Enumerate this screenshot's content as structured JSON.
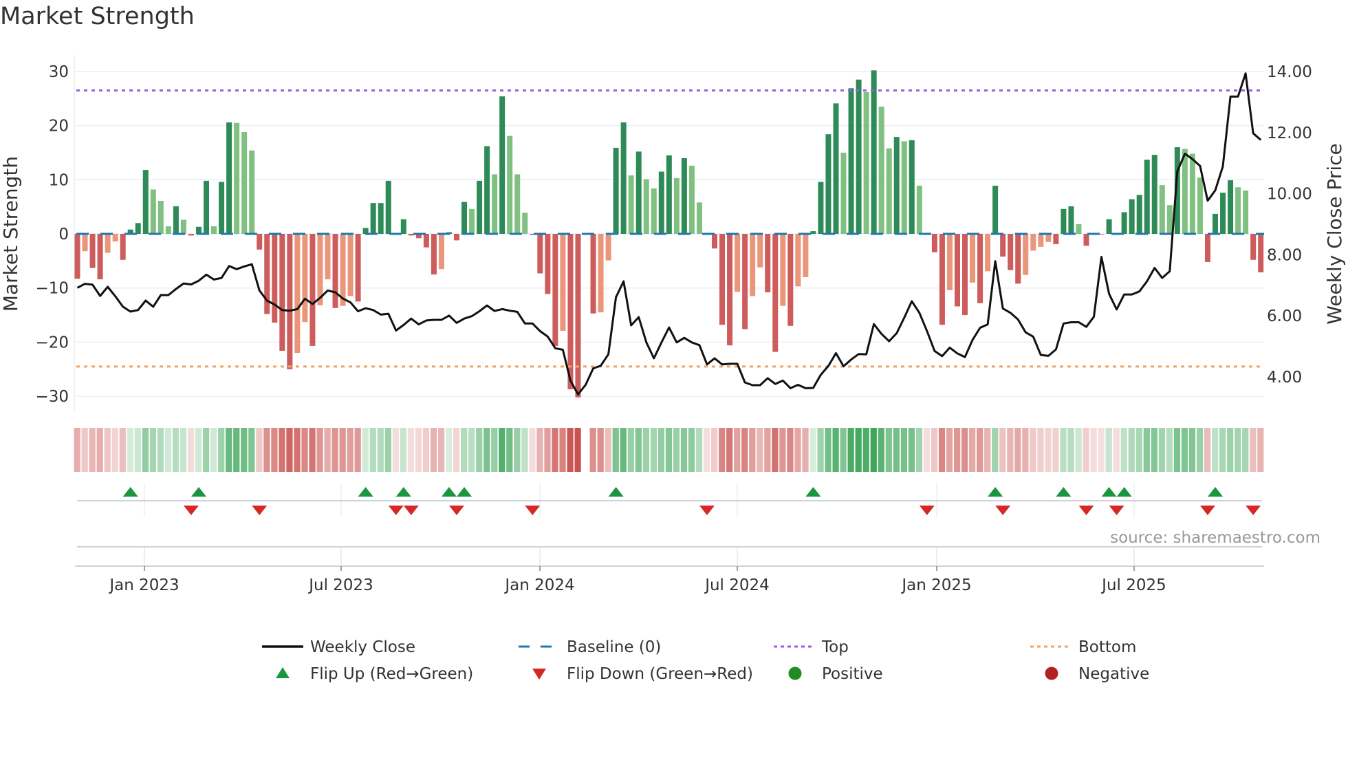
{
  "title": "Market Strength",
  "source": "source: sharemaestro.com",
  "chart_data": {
    "type": "bar+line",
    "title": "Market Strength",
    "ylabel_left": "Market Strength",
    "ylabel_right": "Weekly Close Price",
    "ylim_left": [
      -33,
      33
    ],
    "ylim_right": [
      3.2,
      14.6
    ],
    "left_ticks": [
      30,
      20,
      10,
      0,
      -10,
      -20,
      -30
    ],
    "left_tick_labels": [
      "30",
      "20",
      "10",
      "0",
      "−10",
      "−20",
      "−30"
    ],
    "right_ticks": [
      14,
      12,
      10,
      8,
      6,
      4
    ],
    "right_tick_labels": [
      "14.00",
      "12.00",
      "10.00",
      "8.00",
      "6.00",
      "4.00"
    ],
    "x_ticks_week_index": [
      8.84,
      34.77,
      60.97,
      86.99,
      113.28,
      139.3
    ],
    "x_tick_labels": [
      "Jan 2023",
      "Jul 2023",
      "Jan 2024",
      "Jul 2024",
      "Jan 2025",
      "Jul 2025"
    ],
    "grid": true,
    "top_level": 26.5,
    "bottom_level": -24.5,
    "baseline": 0,
    "strength": [
      -8.3,
      -3.2,
      -6.3,
      -8.4,
      -3.5,
      -1.4,
      -4.8,
      0.8,
      2.0,
      11.8,
      8.2,
      6.1,
      1.4,
      5.1,
      2.6,
      -0.3,
      1.3,
      9.8,
      1.4,
      9.6,
      20.6,
      20.5,
      18.8,
      15.4,
      -2.9,
      -14.8,
      -16.4,
      -21.6,
      -25.0,
      -22.0,
      -16.3,
      -20.7,
      -13.2,
      -8.4,
      -13.7,
      -13.3,
      -11.5,
      -12.5,
      1.1,
      5.7,
      5.7,
      9.8,
      -0.2,
      2.7,
      -0.3,
      -0.8,
      -2.5,
      -7.5,
      -6.5,
      0.3,
      -1.2,
      5.9,
      4.6,
      9.8,
      16.2,
      11.0,
      25.4,
      18.1,
      11.0,
      3.9,
      -0.2,
      -7.3,
      -11.1,
      -20.7,
      -17.9,
      -28.7,
      -30.2,
      0,
      -14.7,
      -14.5,
      -4.9,
      15.9,
      20.6,
      10.8,
      15.2,
      10.1,
      8.4,
      11.5,
      14.5,
      10.3,
      14.0,
      12.6,
      5.8,
      -0.2,
      -2.7,
      -16.8,
      -20.6,
      -10.7,
      -17.6,
      -11.5,
      -6.2,
      -10.8,
      -21.8,
      -13.3,
      -17.0,
      -9.7,
      -8.0,
      0.5,
      9.6,
      18.4,
      24.1,
      15.0,
      26.9,
      28.5,
      26.2,
      30.2,
      23.5,
      15.8,
      17.9,
      17.1,
      17.3,
      8.9,
      -0.2,
      -3.4,
      -16.8,
      -10.4,
      -13.4,
      -15.0,
      -9.0,
      -12.8,
      -6.9,
      8.9,
      -4.2,
      -6.7,
      -9.2,
      -7.6,
      -3.1,
      -2.4,
      -1.5,
      -1.9,
      4.6,
      5.1,
      1.8,
      -2.2,
      -0.2,
      -0.1,
      2.7,
      -0.2,
      4.0,
      6.4,
      7.2,
      13.7,
      14.6,
      9.0,
      5.3,
      16.0,
      15.7,
      14.8,
      10.4,
      -5.2,
      3.7,
      7.6,
      9.9,
      8.6,
      8.0,
      -4.8,
      -7.1
    ],
    "weekly_close": [
      6.92,
      7.05,
      7.02,
      6.65,
      6.95,
      6.64,
      6.3,
      6.14,
      6.19,
      6.5,
      6.3,
      6.68,
      6.68,
      6.88,
      7.06,
      7.03,
      7.15,
      7.35,
      7.19,
      7.24,
      7.63,
      7.53,
      7.62,
      7.69,
      6.83,
      6.5,
      6.37,
      6.19,
      6.17,
      6.22,
      6.56,
      6.39,
      6.59,
      6.83,
      6.77,
      6.57,
      6.44,
      6.15,
      6.25,
      6.19,
      6.04,
      6.07,
      5.52,
      5.7,
      5.91,
      5.72,
      5.85,
      5.87,
      5.87,
      6.01,
      5.77,
      5.91,
      5.99,
      6.15,
      6.34,
      6.16,
      6.22,
      6.17,
      6.13,
      5.75,
      5.75,
      5.5,
      5.32,
      4.94,
      4.89,
      3.88,
      3.43,
      3.74,
      4.28,
      4.37,
      4.74,
      6.61,
      7.13,
      5.69,
      5.96,
      5.13,
      4.61,
      5.13,
      5.62,
      5.13,
      5.28,
      5.13,
      5.04,
      4.41,
      4.61,
      4.41,
      4.43,
      4.43,
      3.82,
      3.73,
      3.73,
      3.96,
      3.77,
      3.88,
      3.63,
      3.74,
      3.63,
      3.64,
      4.07,
      4.36,
      4.78,
      4.35,
      4.57,
      4.75,
      4.74,
      5.73,
      5.41,
      5.17,
      5.43,
      5.94,
      6.48,
      6.1,
      5.5,
      4.85,
      4.68,
      4.96,
      4.77,
      4.65,
      5.21,
      5.61,
      5.72,
      7.79,
      6.24,
      6.1,
      5.88,
      5.46,
      5.32,
      4.72,
      4.69,
      4.9,
      5.75,
      5.79,
      5.79,
      5.64,
      5.97,
      7.93,
      6.72,
      6.21,
      6.7,
      6.7,
      6.8,
      7.13,
      7.57,
      7.24,
      7.46,
      10.73,
      11.31,
      11.13,
      10.91,
      9.77,
      10.11,
      10.89,
      13.18,
      13.18,
      13.94,
      11.98,
      11.76
    ],
    "flip_up_weeks": [
      7,
      16,
      38,
      43,
      49,
      51,
      71,
      97,
      121,
      130,
      136,
      138,
      150
    ],
    "flip_down_weeks": [
      15,
      24,
      42,
      44,
      50,
      60,
      83,
      112,
      122,
      133,
      137,
      149,
      155
    ],
    "legend": [
      {
        "label": "Weekly Close",
        "symbol": "line",
        "color": "#111111"
      },
      {
        "label": "Baseline (0)",
        "symbol": "dash",
        "color": "#1f77b4"
      },
      {
        "label": "Top",
        "symbol": "dot",
        "color": "#9b5de5"
      },
      {
        "label": "Bottom",
        "symbol": "dot",
        "color": "#f4a261"
      },
      {
        "label": "Flip Up (Red→Green)",
        "symbol": "triangle-up",
        "color": "#1a9641"
      },
      {
        "label": "Flip Down (Green→Red)",
        "symbol": "triangle-down",
        "color": "#d62728"
      },
      {
        "label": "Positive",
        "symbol": "circle",
        "color": "#228b22"
      },
      {
        "label": "Negative",
        "symbol": "circle",
        "color": "#b22222"
      }
    ],
    "legend_placement": "bottom",
    "colors": {
      "pos_strong": "#2e8b57",
      "pos_weak": "#80c080",
      "neg_strong": "#cd5c5c",
      "neg_weak": "#e9967a",
      "heat_pos": "#3fa65a",
      "heat_neg": "#c9534f"
    }
  }
}
